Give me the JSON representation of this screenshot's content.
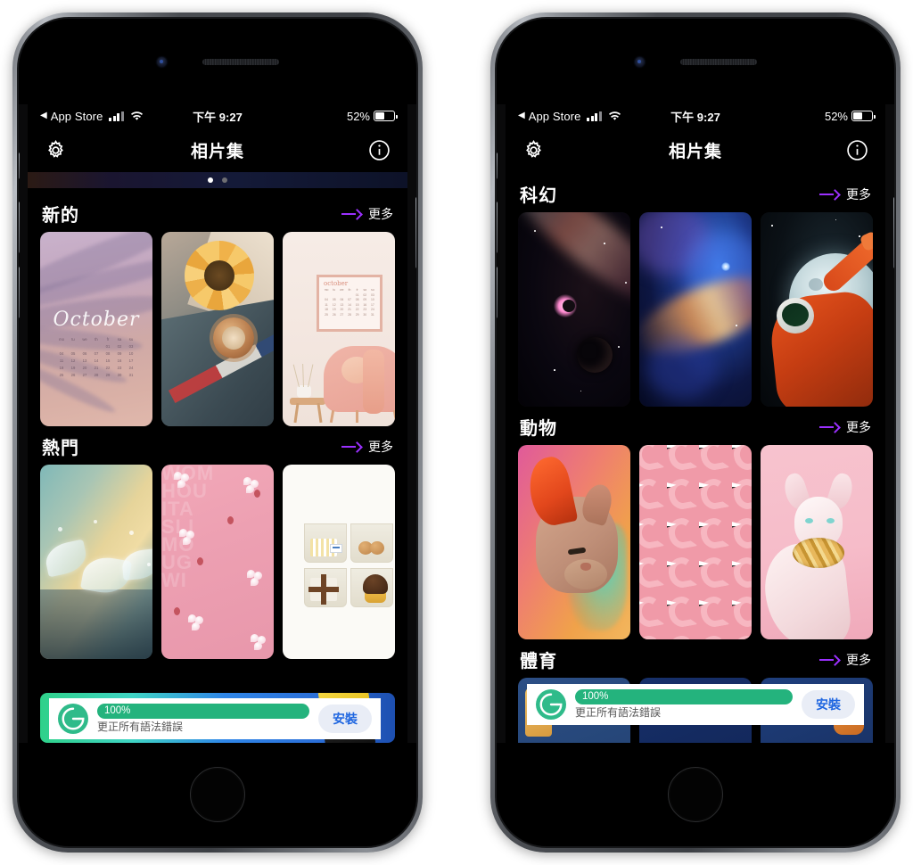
{
  "device": {
    "home_button": "home-button",
    "camera": "front-camera",
    "speaker": "earpiece-speaker"
  },
  "status_bar": {
    "back_label": "App Store",
    "back_arrow": "◀",
    "signal": "signal-bars-icon",
    "wifi": "wifi-icon",
    "time": "下午 9:27",
    "battery_percent": "52%",
    "battery": "battery-icon"
  },
  "nav_bar": {
    "settings_icon": "gear-icon",
    "title": "相片集",
    "info_icon": "info-circle-icon"
  },
  "left_phone": {
    "pager": {
      "dots": 2,
      "active_index": 0
    },
    "sections": [
      {
        "title": "新的",
        "more_label": "更多",
        "arrow_icon": "arrow-right-icon",
        "thumbs": [
          {
            "name": "october-palm-shadow-calendar",
            "caption": "October"
          },
          {
            "name": "sunflower-watch-denim-flatlay",
            "caption": ""
          },
          {
            "name": "pink-armchair-october-frame",
            "caption": "october"
          }
        ]
      },
      {
        "title": "熱門",
        "more_label": "更多",
        "arrow_icon": "arrow-right-icon",
        "thumbs": [
          {
            "name": "water-splash-butterflies",
            "caption": ""
          },
          {
            "name": "pink-cherry-blossoms",
            "caption": ""
          },
          {
            "name": "sweets-shelf-boxes",
            "caption": ""
          }
        ]
      }
    ]
  },
  "right_phone": {
    "sections": [
      {
        "title": "科幻",
        "more_label": "更多",
        "arrow_icon": "arrow-right-icon",
        "thumbs": [
          {
            "name": "galaxy-dark-planet",
            "caption": ""
          },
          {
            "name": "blue-orange-nebula",
            "caption": ""
          },
          {
            "name": "astronaut-pointing-moon",
            "caption": ""
          }
        ]
      },
      {
        "title": "動物",
        "more_label": "更多",
        "arrow_icon": "arrow-right-icon",
        "thumbs": [
          {
            "name": "sphynx-cat-neon-light",
            "caption": ""
          },
          {
            "name": "flamingo-pattern",
            "caption": ""
          },
          {
            "name": "white-sphynx-gold-chain",
            "caption": ""
          }
        ]
      },
      {
        "title": "體育",
        "more_label": "更多",
        "arrow_icon": "arrow-right-icon",
        "thumbs": [
          {
            "name": "sports-thumb-1",
            "caption": ""
          },
          {
            "name": "sports-thumb-2",
            "caption": ""
          },
          {
            "name": "sports-thumb-3",
            "caption": ""
          }
        ]
      }
    ]
  },
  "ad": {
    "logo": "grammarly-g-icon",
    "progress_label": "100%",
    "subtitle": "更正所有語法錯誤",
    "install_label": "安裝"
  },
  "calendars": {
    "october_weekdays": [
      "mo",
      "tu",
      "we",
      "th",
      "fr",
      "sa",
      "su"
    ],
    "october_days": [
      "01",
      "02",
      "03",
      "04",
      "05",
      "06",
      "07",
      "08",
      "09",
      "10",
      "11",
      "12",
      "13",
      "14",
      "15",
      "16",
      "17",
      "18",
      "19",
      "20",
      "21",
      "22",
      "23",
      "24",
      "25",
      "26",
      "27",
      "28",
      "29",
      "30",
      "31"
    ]
  },
  "colors": {
    "accent_purple": "#9b30ff",
    "screen_bg": "#000000",
    "ad_green": "#24b37d",
    "ad_install_blue": "#1f66e0"
  }
}
